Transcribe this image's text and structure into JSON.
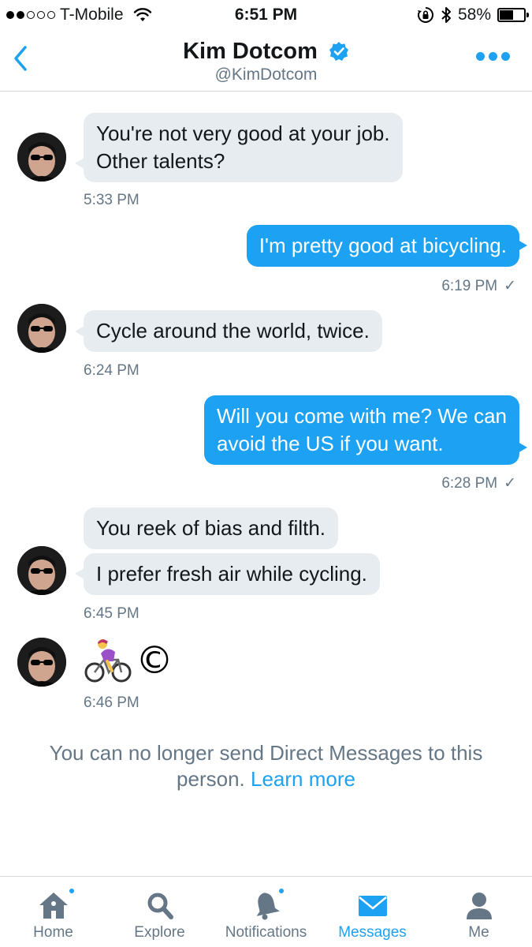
{
  "status_bar": {
    "carrier": "T-Mobile",
    "time": "6:51 PM",
    "battery_percent": "58%",
    "battery_level": 0.58,
    "signal_bars_filled": 2,
    "signal_bars_total": 5
  },
  "header": {
    "name": "Kim Dotcom",
    "handle": "@KimDotcom",
    "verified": true,
    "accent_color": "#1da1f2"
  },
  "messages": [
    {
      "direction": "in",
      "text_lines": [
        "You're not very good at your job.",
        "Other talents?"
      ],
      "time": "5:33 PM"
    },
    {
      "direction": "out",
      "text_lines": [
        "I'm pretty good at bicycling."
      ],
      "time": "6:19 PM",
      "status": "✓"
    },
    {
      "direction": "in",
      "text_lines": [
        "Cycle around the world, twice."
      ],
      "time": "6:24 PM"
    },
    {
      "direction": "out",
      "text_lines": [
        "Will you come with me? We can",
        "avoid the US if you want."
      ],
      "time": "6:28 PM",
      "status": "✓"
    },
    {
      "direction": "in",
      "text_lines": [
        "You reek of bias and filth."
      ]
    },
    {
      "direction": "in",
      "text_lines": [
        "I prefer fresh air while cycling."
      ],
      "time": "6:45 PM"
    },
    {
      "direction": "in",
      "emoji": [
        "woman-biking-emoji",
        "copyright-emoji"
      ],
      "copyright_glyph": "©",
      "time": "6:46 PM"
    }
  ],
  "notice": {
    "text": "You can no longer send Direct Messages to this person.",
    "link": "Learn more"
  },
  "tabs": [
    {
      "label": "Home",
      "icon": "home-icon",
      "has_badge": true
    },
    {
      "label": "Explore",
      "icon": "search-icon",
      "has_badge": false
    },
    {
      "label": "Notifications",
      "icon": "bell-icon",
      "has_badge": true
    },
    {
      "label": "Messages",
      "icon": "envelope-icon",
      "active": true
    },
    {
      "label": "Me",
      "icon": "person-icon",
      "has_badge": false
    }
  ],
  "colors": {
    "tab_inactive": "#657786",
    "tab_active": "#1da1f2",
    "incoming_bubble": "#e6ecf0",
    "outgoing_bubble": "#1da1f2"
  }
}
